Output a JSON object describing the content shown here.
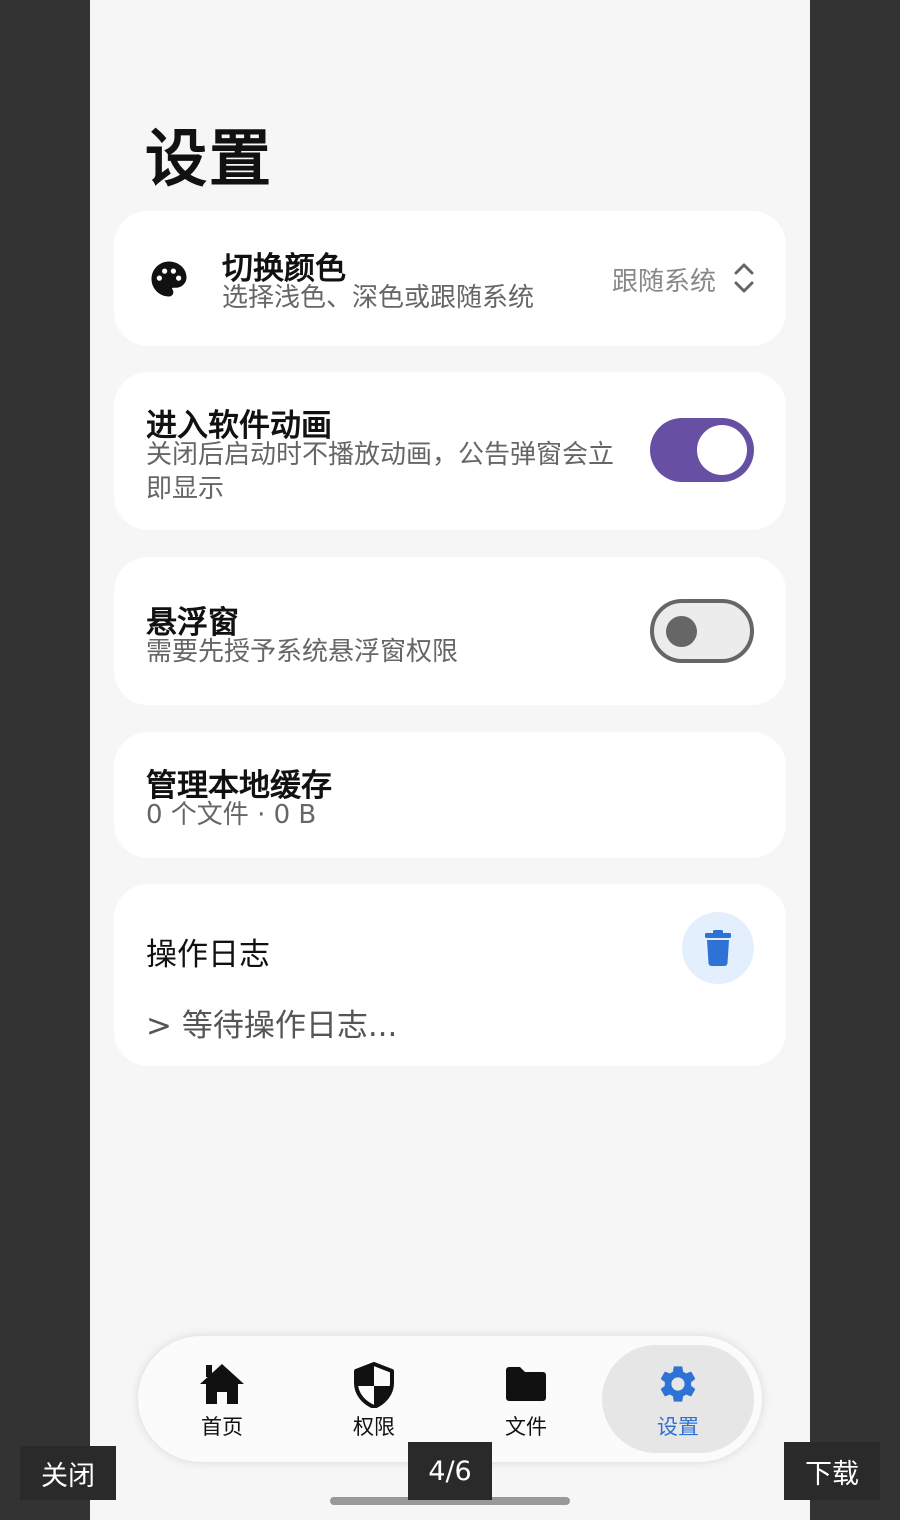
{
  "page": {
    "title": "设置"
  },
  "settings": {
    "theme": {
      "title": "切换颜色",
      "subtitle": "选择浅色、深色或跟随系统",
      "value": "跟随系统",
      "icon": "palette-icon"
    },
    "intro_animation": {
      "title": "进入软件动画",
      "subtitle": "关闭后启动时不播放动画，公告弹窗会立即显示",
      "enabled": true
    },
    "floating_window": {
      "title": "悬浮窗",
      "subtitle": "需要先授予系统悬浮窗权限",
      "enabled": false
    },
    "cache": {
      "title": "管理本地缓存",
      "subtitle": "0 个文件 · 0 B"
    },
    "log": {
      "title": "操作日志",
      "content": "> 等待操作日志...",
      "clear_icon": "trash-icon"
    }
  },
  "nav": {
    "items": [
      {
        "label": "首页",
        "icon": "home-icon"
      },
      {
        "label": "权限",
        "icon": "shield-icon"
      },
      {
        "label": "文件",
        "icon": "folder-icon"
      },
      {
        "label": "设置",
        "icon": "gear-icon",
        "active": true
      }
    ]
  },
  "viewer": {
    "close": "关闭",
    "counter": "4/6",
    "download": "下载"
  },
  "colors": {
    "accent": "#6750a4",
    "nav_active": "#2f72d6",
    "trash_blue": "#2f72d6"
  }
}
